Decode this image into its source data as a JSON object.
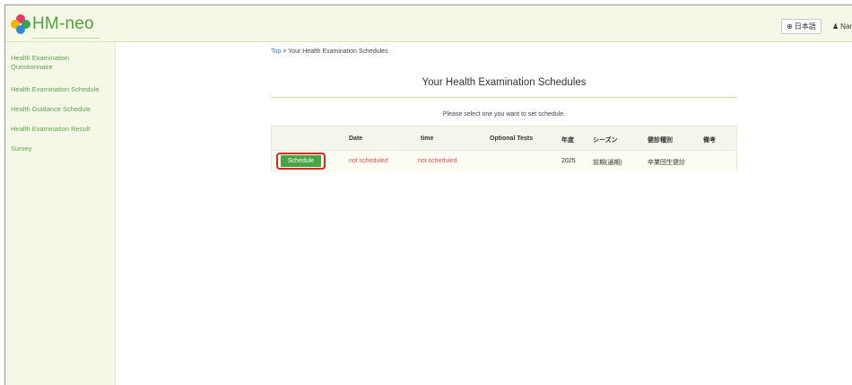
{
  "header": {
    "logo_text": "HM-neo",
    "language_label": "日本語",
    "user_label": "Nar"
  },
  "sidebar": {
    "items": [
      {
        "label": "Health Examination Questionnaire"
      },
      {
        "label": "Health Examination Schedule"
      },
      {
        "label": "Health Guidance Schedule"
      },
      {
        "label": "Health Examination Result"
      },
      {
        "label": "Survey"
      }
    ]
  },
  "breadcrumb": {
    "top": "Top",
    "separator": " > ",
    "current": "Your Health Examination Schedules"
  },
  "main": {
    "title": "Your Health Examination Schedules",
    "instruction": "Please select one you want to set schedule."
  },
  "table": {
    "headers": [
      "Date",
      "time",
      "Optional Tests",
      "年度",
      "シーズン",
      "健診種別",
      "備考"
    ],
    "rows": [
      {
        "action_label": "Schedule",
        "date": "not scheduled",
        "time": "not scheduled",
        "optional_tests": "",
        "year": "2025",
        "season": "前期(通期)",
        "exam_type": "卒業団生健診",
        "remarks": ""
      }
    ]
  },
  "colors": {
    "brand_green": "#4aa33b",
    "sidebar_bg": "#f6f8e7",
    "button_green": "#47a447",
    "highlight_red": "#e0251b",
    "status_red": "#d9534f",
    "link_blue": "#3a7bd5"
  },
  "icons": {
    "logo": "clover-icon",
    "language": "globe-icon",
    "user": "user-icon"
  }
}
